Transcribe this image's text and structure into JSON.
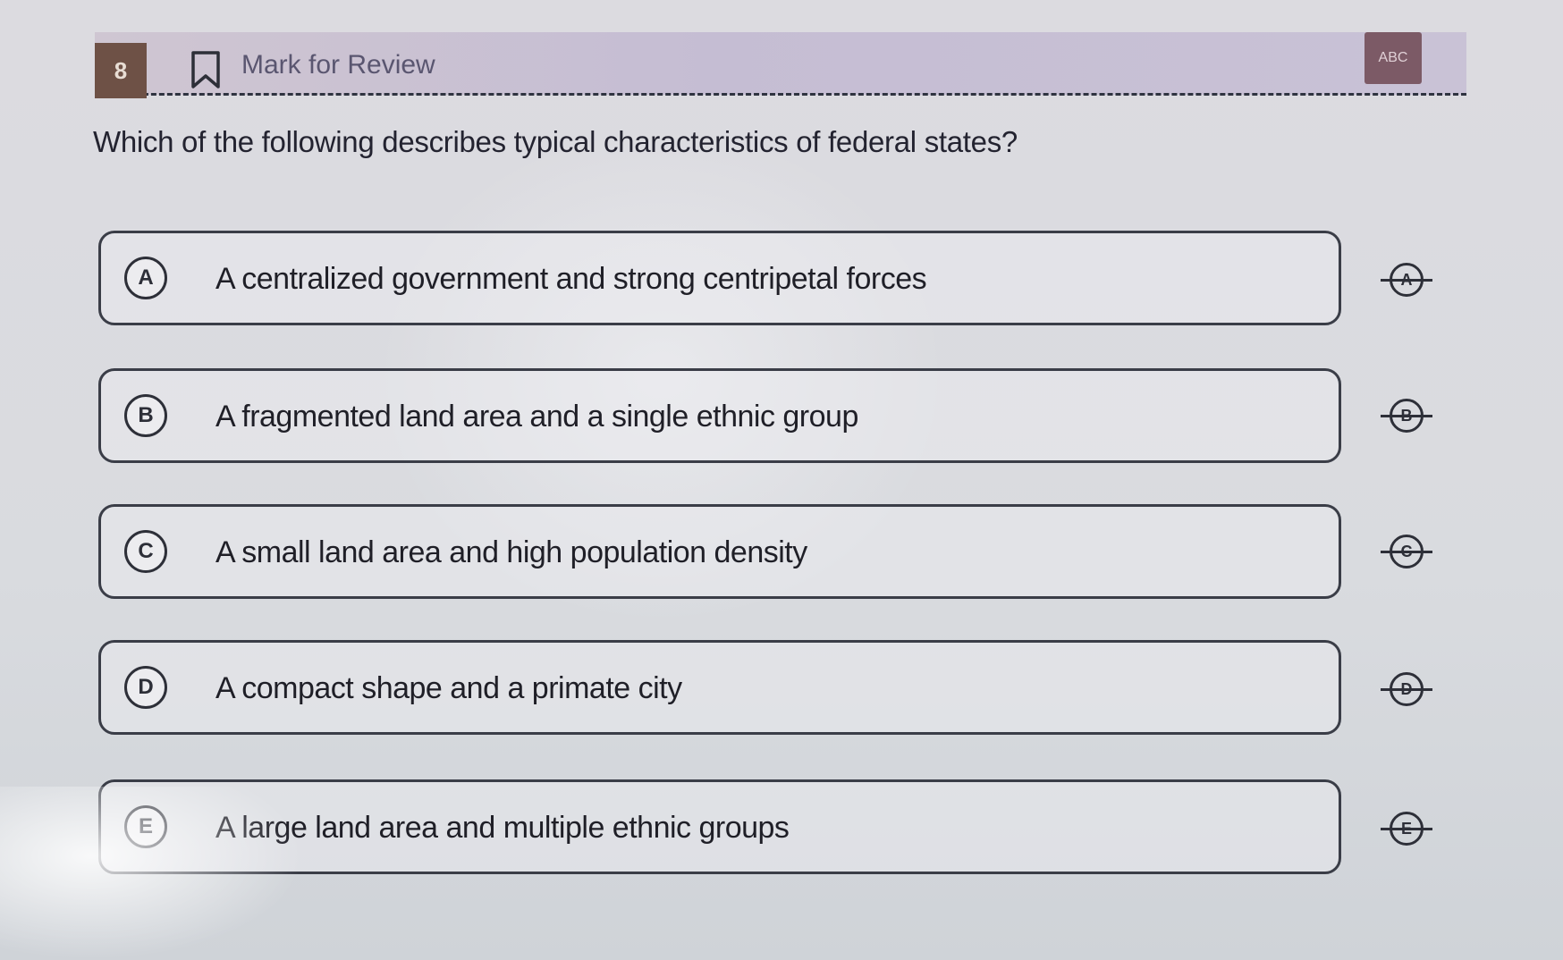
{
  "header": {
    "question_number": "8",
    "mark_for_review": "Mark for Review",
    "abc_label": "ABC"
  },
  "question": {
    "text": "Which of the following describes typical characteristics of federal states?"
  },
  "options": [
    {
      "letter": "A",
      "text": "A centralized government and strong centripetal forces",
      "strike_icon": "A"
    },
    {
      "letter": "B",
      "text": "A fragmented land area and a single ethnic group",
      "strike_icon": "B"
    },
    {
      "letter": "C",
      "text": "A small land area and high population density",
      "strike_icon": "C"
    },
    {
      "letter": "D",
      "text": "A compact shape and a primate city",
      "strike_icon": "D"
    },
    {
      "letter": "E",
      "text": "A large land area and multiple ethnic groups",
      "strike_icon": "E"
    }
  ],
  "colors": {
    "accent_number": "#6e5146",
    "abc_badge": "#7c5a66",
    "header_bar": "#c5bdd3"
  }
}
